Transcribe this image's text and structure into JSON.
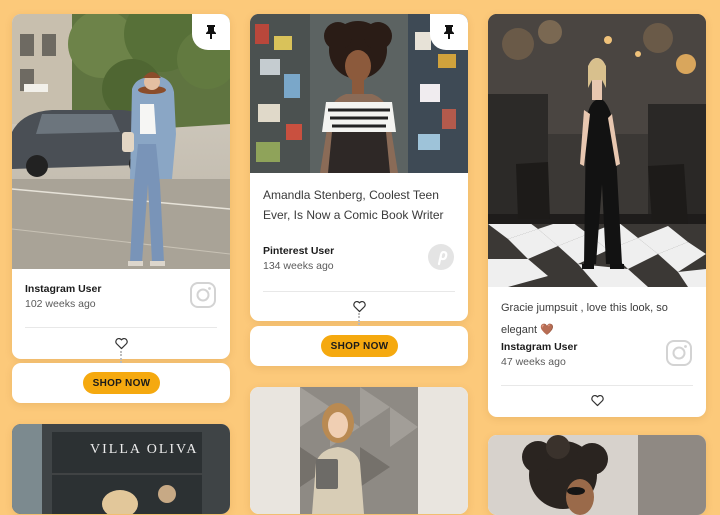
{
  "colors": {
    "background": "#fcc97a",
    "card": "#ffffff",
    "shop_button": "#f5a90f",
    "heart_emoji": "#f3a383"
  },
  "feed": {
    "columns": [
      {
        "posts": [
          {
            "type": "photo-post",
            "pinned": true,
            "source_icon": "instagram-icon",
            "user": "Instagram User",
            "time_ago": "102 weeks ago",
            "like_icon": "heart-icon",
            "shop_label": "SHOP NOW"
          },
          {
            "type": "photo-post",
            "photo_text": "VILLA OLIVA"
          }
        ]
      },
      {
        "posts": [
          {
            "type": "article-post",
            "pinned": true,
            "title": "Amandla Stenberg, Coolest Teen Ever, Is Now a Comic Book Writer",
            "source_icon": "pinterest-icon",
            "user": "Pinterest User",
            "time_ago": "134 weeks ago",
            "like_icon": "heart-icon",
            "shop_label": "SHOP NOW"
          },
          {
            "type": "photo-post"
          }
        ]
      },
      {
        "posts": [
          {
            "type": "caption-post",
            "caption": "Gracie jumpsuit , love this look, so elegant 🤎",
            "source_icon": "instagram-icon",
            "user": "Instagram User",
            "time_ago": "47 weeks ago",
            "like_icon": "heart-icon"
          },
          {
            "type": "photo-post"
          }
        ]
      }
    ]
  }
}
